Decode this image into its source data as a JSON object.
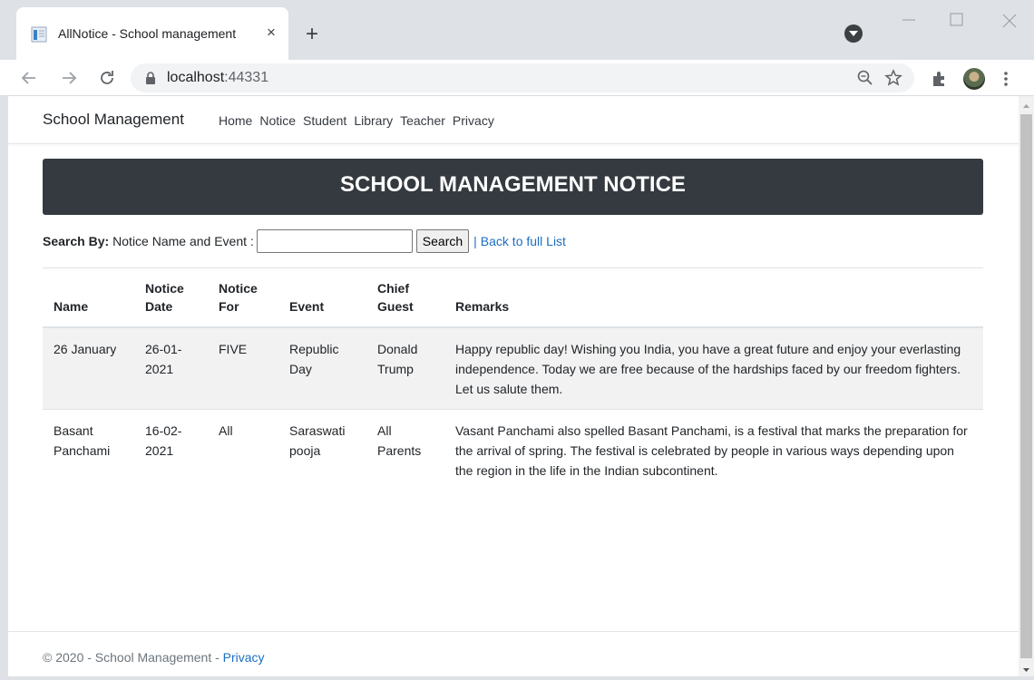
{
  "browser": {
    "tab_title": "AllNotice - School management",
    "tab_close": "×",
    "new_tab": "+",
    "url_host": "localhost",
    "url_port": ":44331"
  },
  "navbar": {
    "brand": "School Management",
    "links": [
      "Home",
      "Notice",
      "Student",
      "Library",
      "Teacher",
      "Privacy"
    ]
  },
  "banner": {
    "title": "SCHOOL MANAGEMENT NOTICE"
  },
  "search": {
    "label_bold": "Search By:",
    "label": "Notice Name and Event :",
    "value": "",
    "button": "Search",
    "separator": "|",
    "back_link": "Back to full List"
  },
  "table": {
    "headers": [
      [
        "Name"
      ],
      [
        "Notice",
        "Date"
      ],
      [
        "Notice",
        "For"
      ],
      [
        "Event"
      ],
      [
        "Chief",
        "Guest"
      ],
      [
        "Remarks"
      ]
    ],
    "rows": [
      {
        "name": "26 January",
        "date": "26-01-2021",
        "for": "FIVE",
        "event": "Republic Day",
        "guest": "Donald Trump",
        "remarks": "Happy republic day! Wishing you India, you have a great future and enjoy your everlasting independence. Today we are free because of the hardships faced by our freedom fighters. Let us salute them."
      },
      {
        "name": "Basant Panchami",
        "date": "16-02-2021",
        "for": "All",
        "event": "Saraswati pooja",
        "guest": "All Parents",
        "remarks": "Vasant Panchami also spelled Basant Panchami, is a festival that marks the preparation for the arrival of spring. The festival is celebrated by people in various ways depending upon the region in the life in the Indian subcontinent."
      }
    ]
  },
  "footer": {
    "text": "© 2020 - School Management - ",
    "privacy": "Privacy"
  },
  "colors": {
    "banner_bg": "#343a40",
    "link": "#1b6ec2",
    "striped_row": "#f2f2f2"
  }
}
